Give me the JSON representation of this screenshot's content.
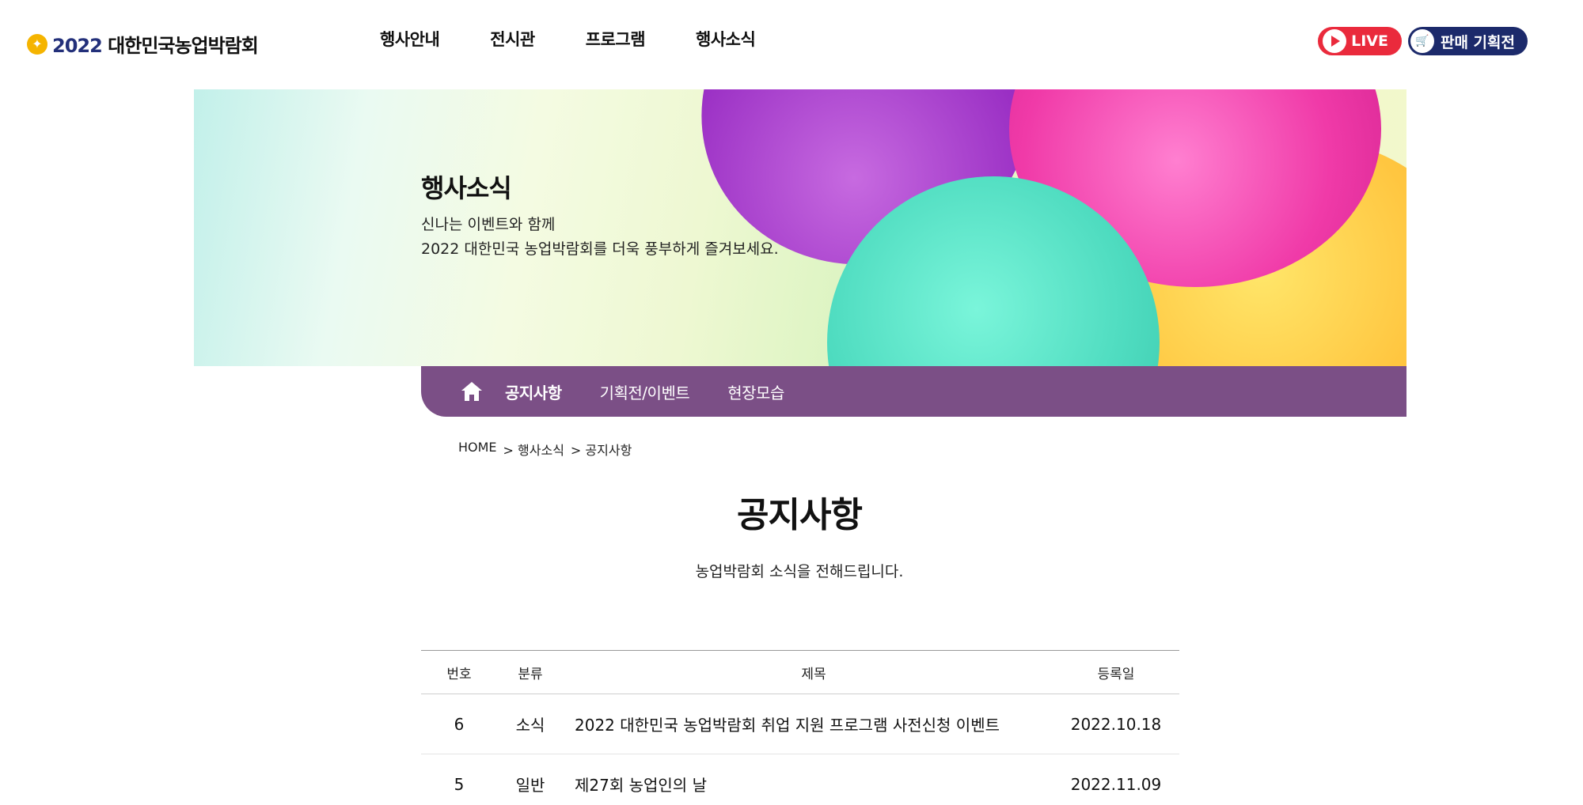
{
  "header": {
    "logo_year": "2022",
    "logo_text": "대한민국농업박람회",
    "nav": [
      "행사안내",
      "전시관",
      "프로그램",
      "행사소식"
    ],
    "live_label": "LIVE",
    "shop_label": "판매 기획전"
  },
  "hero": {
    "title": "행사소식",
    "desc_line1": "신나는 이벤트와 함께",
    "desc_line2": "2022 대한민국 농업박람회를 더욱 풍부하게 즐겨보세요."
  },
  "subnav": {
    "items": [
      "공지사항",
      "기획전/이벤트",
      "현장모습"
    ]
  },
  "breadcrumb": {
    "home": "HOME",
    "level1": "> 행사소식",
    "level2": "> 공지사항"
  },
  "page": {
    "title": "공지사항",
    "subtitle": "농업박람회 소식을 전해드립니다."
  },
  "board": {
    "headers": [
      "번호",
      "분류",
      "제목",
      "등록일"
    ],
    "rows": [
      {
        "num": "6",
        "category": "소식",
        "title": "2022 대한민국 농업박람회 취업 지원 프로그램 사전신청 이벤트",
        "date": "2022.10.18"
      },
      {
        "num": "5",
        "category": "일반",
        "title": "제27회 농업인의 날",
        "date": "2022.11.09"
      }
    ]
  },
  "colors": {
    "subnav_bg": "#7b4f86",
    "live_red": "#ea2a3c",
    "shop_navy": "#1c2a6b",
    "logo_gold": "#f5b400"
  }
}
